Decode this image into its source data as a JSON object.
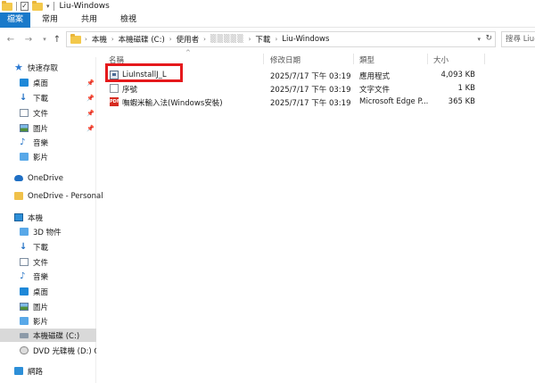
{
  "window": {
    "title": "Liu-Windows"
  },
  "ribbon": {
    "tabs": [
      "檔案",
      "常用",
      "共用",
      "檢視"
    ]
  },
  "address": {
    "crumbs": [
      "本機",
      "本機磁碟 (C:)",
      "使用者",
      "▒▒▒▒▒",
      "下載",
      "Liu-Windows"
    ],
    "search_placeholder": "搜尋 Liu-Windows"
  },
  "sidebar": {
    "quick_access": "快速存取",
    "quick_items": [
      "桌面",
      "下載",
      "文件",
      "圖片",
      "音樂",
      "影片"
    ],
    "onedrive": "OneDrive",
    "onedrive_personal": "OneDrive - Personal",
    "this_pc": "本機",
    "pc_items": [
      "3D 物件",
      "下載",
      "文件",
      "音樂",
      "桌面",
      "圖片",
      "影片",
      "本機磁碟 (C:)",
      "DVD 光碟機 (D:) CP"
    ],
    "network": "網路"
  },
  "columns": {
    "name": "名稱",
    "modified": "修改日期",
    "type": "類型",
    "size": "大小"
  },
  "files": [
    {
      "name": "LiuInstallJ_L",
      "modified": "2025/7/17 下午 03:19",
      "type": "應用程式",
      "size": "4,093 KB",
      "icon": "exe-icon"
    },
    {
      "name": "序號",
      "modified": "2025/7/17 下午 03:19",
      "type": "文字文件",
      "size": "1 KB",
      "icon": "text-file-icon"
    },
    {
      "name": "嘸蝦米輸入法(Windows安裝)",
      "modified": "2025/7/17 下午 03:19",
      "type": "Microsoft Edge P...",
      "size": "365 KB",
      "icon": "pdf-icon"
    }
  ],
  "colors": {
    "accent": "#1979ca",
    "highlight": "#e5191c"
  }
}
